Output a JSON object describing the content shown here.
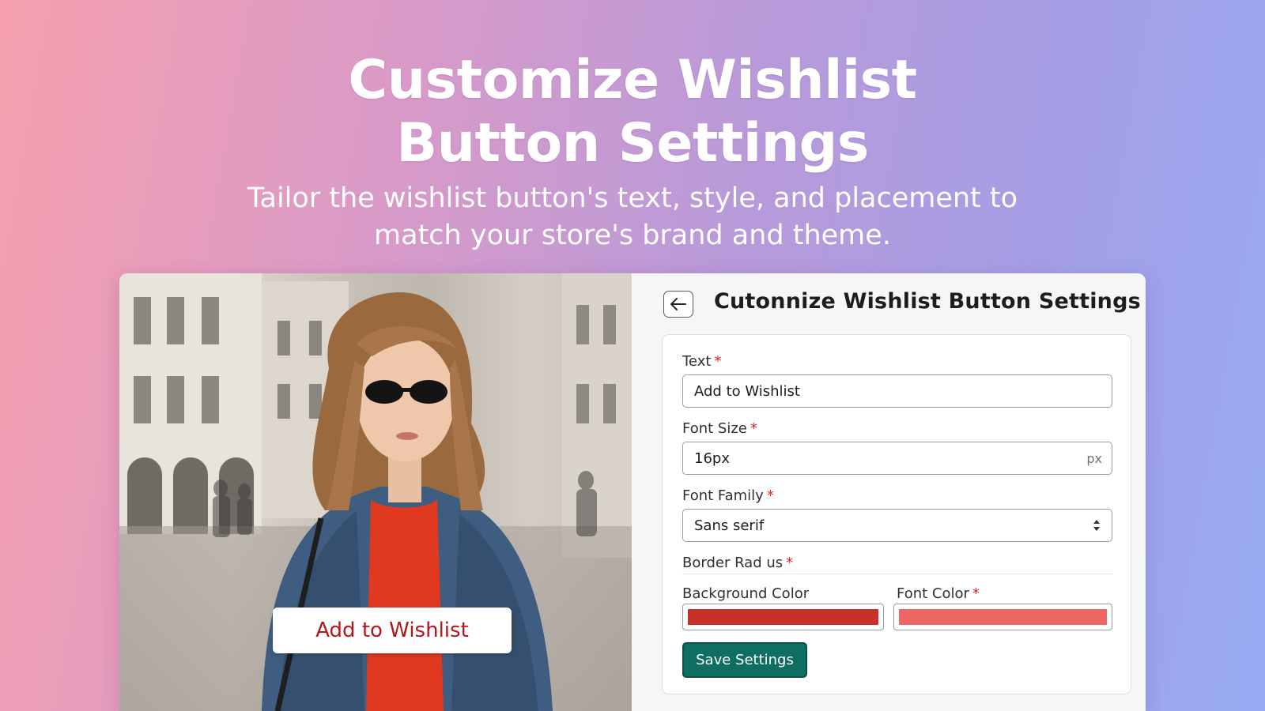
{
  "hero": {
    "title_line1": "Customize Wishlist",
    "title_line2": "Button Settings",
    "subtitle_line1": "Tailor the wishlist button's text, style, and placement to",
    "subtitle_line2": "match your store's brand and theme."
  },
  "preview": {
    "button_label": "Add to Wishlist",
    "button_text_color": "#b0181c"
  },
  "settings": {
    "back_icon": "arrow-left-icon",
    "title": "Cutonnize Wishlist Button Settings",
    "text_label": "Text",
    "text_value": "Add to Wishlist",
    "font_size_label": "Font Size",
    "font_size_value": "16px",
    "font_size_suffix": "px",
    "font_family_label": "Font Family",
    "font_family_value": "Sans serif",
    "border_radius_label": "Border Rad us",
    "background_color_label": "Background Color",
    "background_color_value": "#c8302b",
    "font_color_label": "Font Color",
    "font_color_value": "#ee6764",
    "required_mark": "*",
    "save_label": "Save Settings"
  },
  "colors": {
    "accent_button": "#0f6e62",
    "required": "#dd2222"
  }
}
